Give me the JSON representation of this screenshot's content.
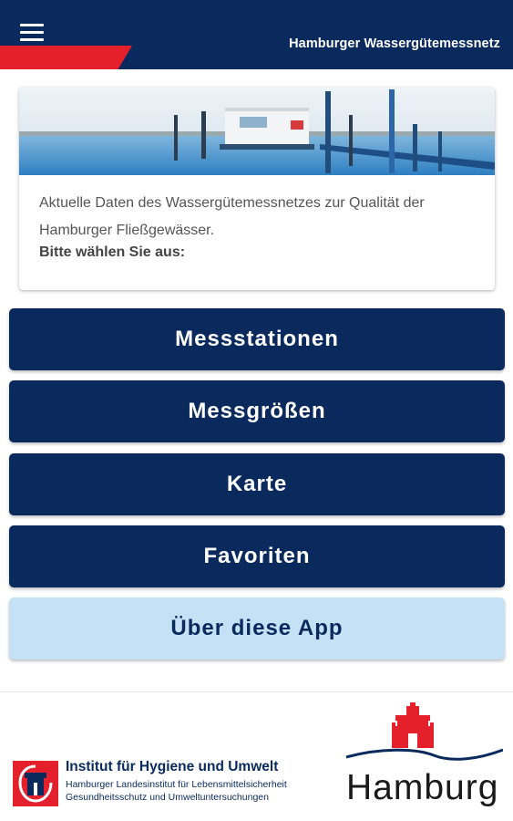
{
  "header": {
    "menu_icon": "hamburger-menu-icon",
    "title": "Hamburger Wassergütemessnetz",
    "background_color": "#0a2a5e",
    "accent_color": "#e3202b"
  },
  "intro_card": {
    "image": "water-measurement-station-photo",
    "text": "Aktuelle Daten des Wassergütemessnetzes zur Qualität der Hamburger Fließgewässer.",
    "prompt": "Bitte wählen Sie aus:"
  },
  "menu": {
    "stations": "Messstationen",
    "parameters": "Messgrößen",
    "map": "Karte",
    "favorites": "Favoriten",
    "about": "Über diese App"
  },
  "footer": {
    "institut": {
      "logo": "institut-hygiene-logo",
      "title": "Institut für Hygiene und Umwelt",
      "subtitle_line1": "Hamburger Landesinstitut für Lebensmittelsicherheit",
      "subtitle_line2": "Gesundheitsschutz und Umweltuntersuchungen"
    },
    "city": {
      "logo": "hamburg-castle-logo",
      "name": "Hamburg"
    }
  }
}
